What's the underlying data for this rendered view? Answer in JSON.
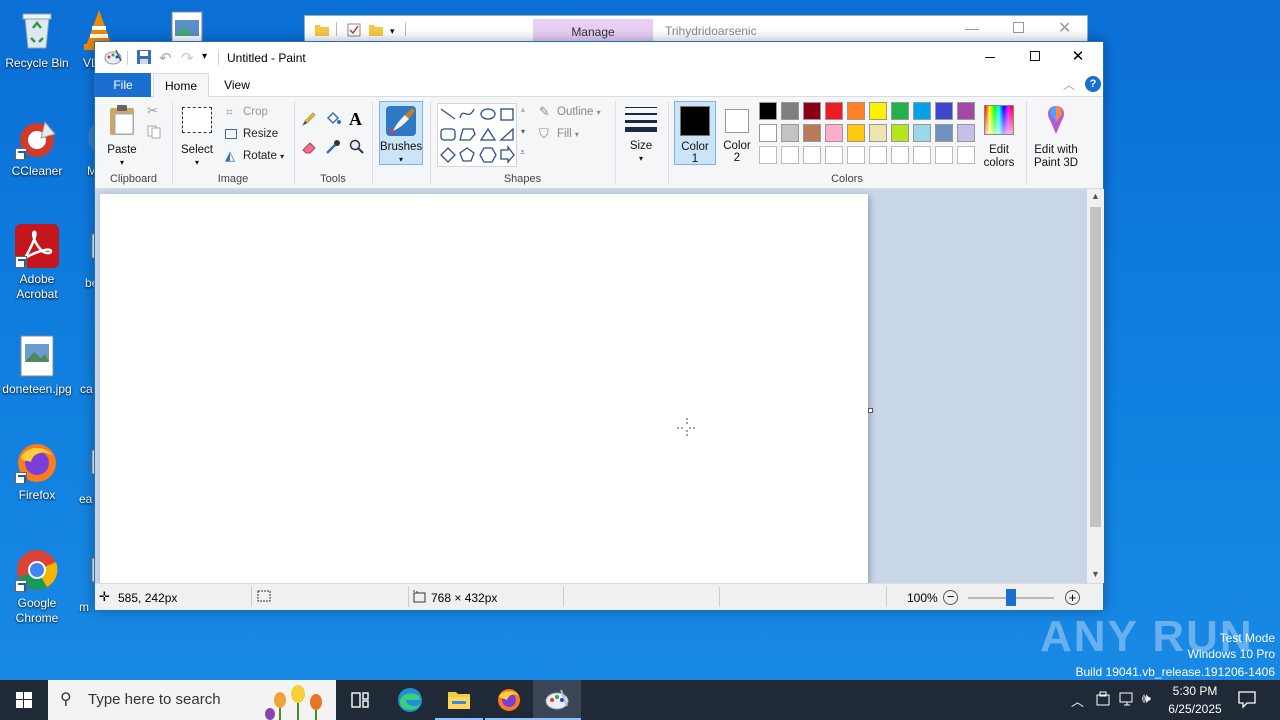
{
  "desktop": {
    "icons": [
      {
        "label": "Recycle Bin"
      },
      {
        "label": "VL"
      },
      {
        "label": "CCleaner"
      },
      {
        "label": "M"
      },
      {
        "label": "Adobe Acrobat"
      },
      {
        "label": "be"
      },
      {
        "label": "doneteen.jpg"
      },
      {
        "label": "ca"
      },
      {
        "label": "Firefox"
      },
      {
        "label": "ea"
      },
      {
        "label": "Google Chrome"
      },
      {
        "label": "m"
      }
    ]
  },
  "explorer": {
    "manage_label": "Manage",
    "title": "Trihydridoarsenic"
  },
  "paint": {
    "title": "Untitled - Paint",
    "tabs": [
      "File",
      "Home",
      "View"
    ],
    "clipboard": {
      "paste": "Paste",
      "label": "Clipboard"
    },
    "image": {
      "select": "Select",
      "crop": "Crop",
      "resize": "Resize",
      "rotate": "Rotate",
      "label": "Image"
    },
    "tools": {
      "label": "Tools"
    },
    "brushes": {
      "label": "Brushes"
    },
    "shapes": {
      "outline": "Outline",
      "fill": "Fill",
      "label": "Shapes"
    },
    "size": {
      "label": "Size"
    },
    "color1": {
      "label1": "Color",
      "label2": "1",
      "value": "#000000"
    },
    "color2": {
      "label1": "Color",
      "label2": "2",
      "value": "#ffffff"
    },
    "colors": {
      "label": "Colors",
      "row1": [
        "#000000",
        "#7f7f7f",
        "#880015",
        "#ed1c24",
        "#ff7f27",
        "#fff200",
        "#22b14c",
        "#00a2e8",
        "#3f48cc",
        "#a349a4"
      ],
      "row2": [
        "#ffffff",
        "#c3c3c3",
        "#b97a57",
        "#ffaec9",
        "#ffc90e",
        "#efe4b0",
        "#b5e61d",
        "#99d9ea",
        "#7092be",
        "#c8bfe7"
      ],
      "row3": [
        "#ffffff",
        "#ffffff",
        "#ffffff",
        "#ffffff",
        "#ffffff",
        "#ffffff",
        "#ffffff",
        "#ffffff",
        "#ffffff",
        "#ffffff"
      ]
    },
    "edit_colors": {
      "line1": "Edit",
      "line2": "colors"
    },
    "paint3d": {
      "line1": "Edit with",
      "line2": "Paint 3D"
    },
    "status": {
      "cursor_pos": "585, 242px",
      "canvas_size": "768 × 432px",
      "zoom": "100%",
      "zoom_fraction": 0.5
    }
  },
  "watermark": {
    "brand": "ANY RUN",
    "line1": "Test Mode",
    "line2": "Windows 10 Pro",
    "line3": "Build 19041.vb_release.191206-1406"
  },
  "taskbar": {
    "search_placeholder": "Type here to search",
    "time": "5:30 PM",
    "date": "6/25/2025"
  }
}
